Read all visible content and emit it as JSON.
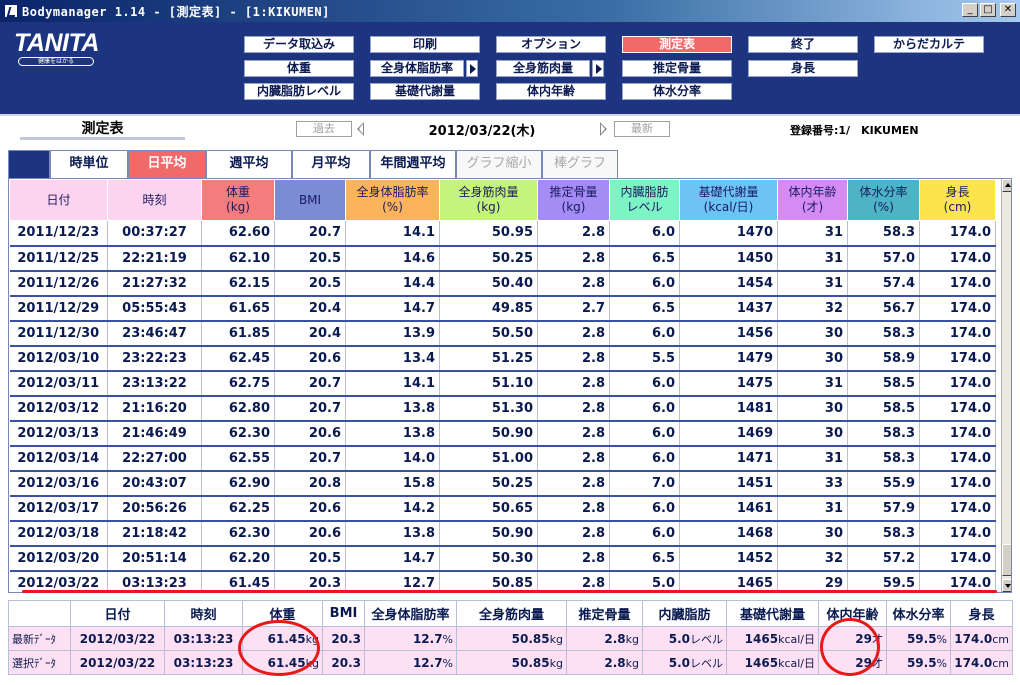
{
  "window": {
    "title": "Bodymanager 1.14 - [測定表] - [1:KIKUMEN]"
  },
  "header": {
    "logo": "TANITA",
    "logo_sub": "健康をはかる",
    "buttons": {
      "import": "データ取込み",
      "print": "印刷",
      "options": "オプション",
      "sheet": "測定表",
      "exit": "終了",
      "karte": "からだカルテ",
      "weight": "体重",
      "body_fat": "全身体脂肪率",
      "muscle": "全身筋肉量",
      "bone": "推定骨量",
      "height": "身長",
      "visceral": "内臓脂肪レベル",
      "bmr": "基礎代謝量",
      "body_age": "体内年齢",
      "water": "体水分率"
    }
  },
  "daterow": {
    "sheet_name": "測定表",
    "prev": "過去",
    "next": "最新",
    "current_date": "2012/03/22(木)",
    "registration": "登録番号:1/　KIKUMEN"
  },
  "tabs": [
    "時単位",
    "日平均",
    "週平均",
    "月平均",
    "年間週平均",
    "グラフ縮小",
    "棒グラフ"
  ],
  "colors": {
    "date": "#fcd4f0",
    "time": "#fcd4f0",
    "weight": "#f47c7c",
    "bmi": "#7c8cd4",
    "fat": "#fcb45c",
    "muscle": "#c4f47c",
    "bone": "#a48cf4",
    "visceral": "#7cf4c4",
    "bmr": "#6cc4f4",
    "age": "#d48cf4",
    "water": "#4cb4c4",
    "height": "#fce44c"
  },
  "table": {
    "headers": [
      [
        "日付",
        ""
      ],
      [
        "時刻",
        ""
      ],
      [
        "体重",
        "(kg)"
      ],
      [
        "BMI",
        ""
      ],
      [
        "全身体脂肪率",
        "(%)"
      ],
      [
        "全身筋肉量",
        "(kg)"
      ],
      [
        "推定骨量",
        "(kg)"
      ],
      [
        "内臓脂肪",
        "レベル"
      ],
      [
        "基礎代謝量",
        "(kcal/日)"
      ],
      [
        "体内年齢",
        "(才)"
      ],
      [
        "体水分率",
        "(%)"
      ],
      [
        "身長",
        "(cm)"
      ]
    ],
    "rows": [
      [
        "2011/12/23",
        "00:37:27",
        "62.60",
        "20.7",
        "14.1",
        "50.95",
        "2.8",
        "6.0",
        "1470",
        "31",
        "58.3",
        "174.0"
      ],
      [
        "2011/12/25",
        "22:21:19",
        "62.10",
        "20.5",
        "14.6",
        "50.25",
        "2.8",
        "6.5",
        "1450",
        "31",
        "57.0",
        "174.0"
      ],
      [
        "2011/12/26",
        "21:27:32",
        "62.15",
        "20.5",
        "14.4",
        "50.40",
        "2.8",
        "6.0",
        "1454",
        "31",
        "57.4",
        "174.0"
      ],
      [
        "2011/12/29",
        "05:55:43",
        "61.65",
        "20.4",
        "14.7",
        "49.85",
        "2.7",
        "6.5",
        "1437",
        "32",
        "56.7",
        "174.0"
      ],
      [
        "2011/12/30",
        "23:46:47",
        "61.85",
        "20.4",
        "13.9",
        "50.50",
        "2.8",
        "6.0",
        "1456",
        "30",
        "58.3",
        "174.0"
      ],
      [
        "2012/03/10",
        "23:22:23",
        "62.45",
        "20.6",
        "13.4",
        "51.25",
        "2.8",
        "5.5",
        "1479",
        "30",
        "58.9",
        "174.0"
      ],
      [
        "2012/03/11",
        "23:13:22",
        "62.75",
        "20.7",
        "14.1",
        "51.10",
        "2.8",
        "6.0",
        "1475",
        "31",
        "58.5",
        "174.0"
      ],
      [
        "2012/03/12",
        "21:16:20",
        "62.80",
        "20.7",
        "13.8",
        "51.30",
        "2.8",
        "6.0",
        "1481",
        "30",
        "58.5",
        "174.0"
      ],
      [
        "2012/03/13",
        "21:46:49",
        "62.30",
        "20.6",
        "13.8",
        "50.90",
        "2.8",
        "6.0",
        "1469",
        "30",
        "58.3",
        "174.0"
      ],
      [
        "2012/03/14",
        "22:27:00",
        "62.55",
        "20.7",
        "14.0",
        "51.00",
        "2.8",
        "6.0",
        "1471",
        "31",
        "58.3",
        "174.0"
      ],
      [
        "2012/03/16",
        "20:43:07",
        "62.90",
        "20.8",
        "15.8",
        "50.25",
        "2.8",
        "7.0",
        "1451",
        "33",
        "55.9",
        "174.0"
      ],
      [
        "2012/03/17",
        "20:56:26",
        "62.25",
        "20.6",
        "14.2",
        "50.65",
        "2.8",
        "6.0",
        "1461",
        "31",
        "57.9",
        "174.0"
      ],
      [
        "2012/03/18",
        "21:18:42",
        "62.30",
        "20.6",
        "13.8",
        "50.90",
        "2.8",
        "6.0",
        "1468",
        "30",
        "58.3",
        "174.0"
      ],
      [
        "2012/03/20",
        "20:51:14",
        "62.20",
        "20.5",
        "14.7",
        "50.30",
        "2.8",
        "6.5",
        "1452",
        "32",
        "57.2",
        "174.0"
      ],
      [
        "2012/03/22",
        "03:13:23",
        "61.45",
        "20.3",
        "12.7",
        "50.85",
        "2.8",
        "5.0",
        "1465",
        "29",
        "59.5",
        "174.0"
      ]
    ]
  },
  "summary": {
    "headers": [
      "",
      "日付",
      "時刻",
      "体重",
      "BMI",
      "全身体脂肪率",
      "全身筋肉量",
      "推定骨量",
      "内臓脂肪",
      "基礎代謝量",
      "体内年齢",
      "体水分率",
      "身長"
    ],
    "rows": [
      {
        "label": "最新ﾃﾞｰﾀ",
        "date": "2012/03/22",
        "time": "03:13:23",
        "weight": "61.45",
        "weight_unit": "kg",
        "bmi": "20.3",
        "fat": "12.7",
        "fat_unit": "%",
        "muscle": "50.85",
        "muscle_unit": "kg",
        "bone": "2.8",
        "bone_unit": "kg",
        "visceral": "5.0",
        "visceral_unit": "レベル",
        "bmr": "1465",
        "bmr_unit": "kcal/日",
        "age": "29",
        "age_unit": "才",
        "water": "59.5",
        "water_unit": "%",
        "height": "174.0",
        "height_unit": "cm"
      },
      {
        "label": "選択ﾃﾞｰﾀ",
        "date": "2012/03/22",
        "time": "03:13:23",
        "weight": "61.45",
        "weight_unit": "kg",
        "bmi": "20.3",
        "fat": "12.7",
        "fat_unit": "%",
        "muscle": "50.85",
        "muscle_unit": "kg",
        "bone": "2.8",
        "bone_unit": "kg",
        "visceral": "5.0",
        "visceral_unit": "レベル",
        "bmr": "1465",
        "bmr_unit": "kcal/日",
        "age": "29",
        "age_unit": "才",
        "water": "59.5",
        "water_unit": "%",
        "height": "174.0",
        "height_unit": "cm"
      }
    ]
  }
}
